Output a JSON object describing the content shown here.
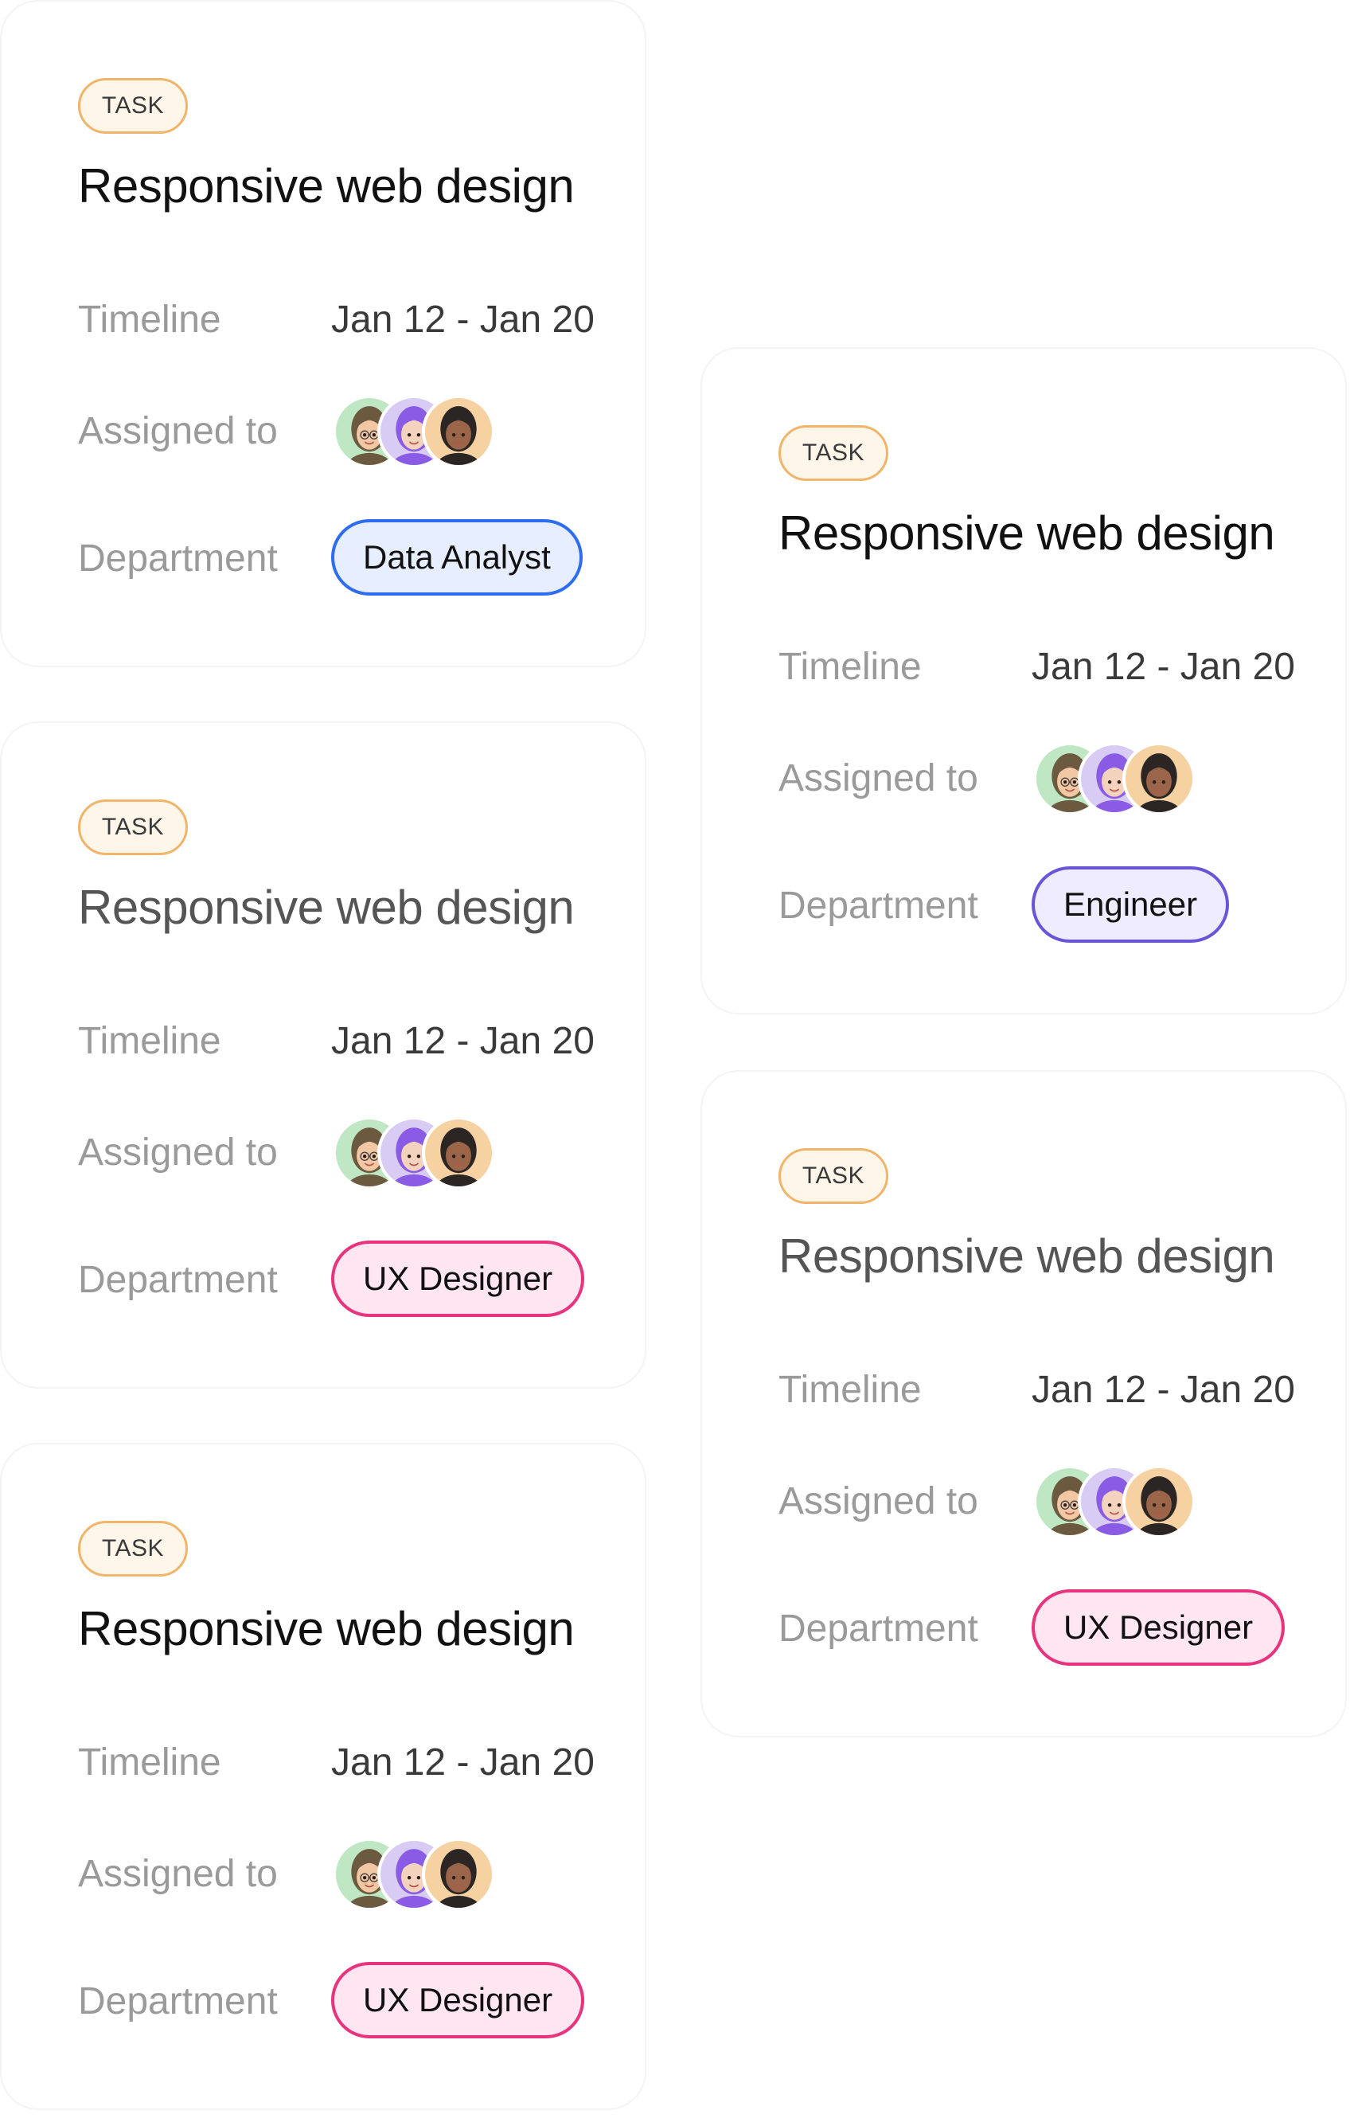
{
  "cards": [
    {
      "badge": "TASK",
      "title": "Responsive web design",
      "timeline_label": "Timeline",
      "timeline_value": "Jan 12 - Jan 20",
      "assigned_label": "Assigned to",
      "department_label": "Department",
      "department": "Data Analyst",
      "department_color": "#2f6df0"
    },
    {
      "badge": "TASK",
      "title": "Responsive web design",
      "timeline_label": "Timeline",
      "timeline_value": "Jan 12 - Jan 20",
      "assigned_label": "Assigned to",
      "department_label": "Department",
      "department": "Engineer",
      "department_color": "#6a55d8"
    },
    {
      "badge": "TASK",
      "title": "Responsive web design",
      "timeline_label": "Timeline",
      "timeline_value": "Jan 12 - Jan 20",
      "assigned_label": "Assigned to",
      "department_label": "Department",
      "department": "UX Designer",
      "department_color": "#e8337f"
    },
    {
      "badge": "TASK",
      "title": "Responsive web design",
      "timeline_label": "Timeline",
      "timeline_value": "Jan 12 - Jan 20",
      "assigned_label": "Assigned to",
      "department_label": "Department",
      "department": "UX Designer",
      "department_color": "#e8337f"
    },
    {
      "badge": "TASK",
      "title": "Responsive web design",
      "timeline_label": "Timeline",
      "timeline_value": "Jan 12 - Jan 20",
      "assigned_label": "Assigned to",
      "department_label": "Department",
      "department": "UX Designer",
      "department_color": "#e8337f"
    }
  ],
  "avatars": [
    "avatar-icon",
    "avatar-icon",
    "avatar-icon"
  ]
}
